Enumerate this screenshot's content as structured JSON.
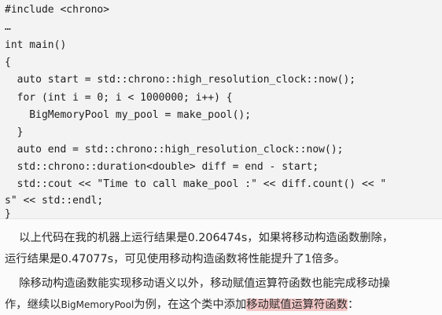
{
  "code": {
    "lines": [
      "#include <chrono>",
      "…",
      "int main()",
      "{",
      "  auto start = std::chrono::high_resolution_clock::now();",
      "  for (int i = 0; i < 1000000; i++) {",
      "    BigMemoryPool my_pool = make_pool();",
      "  }",
      "  auto end = std::chrono::high_resolution_clock::now();",
      "  std::chrono::duration<double> diff = end - start;",
      "  std::cout << \"Time to call make_pool :\" << diff.count() << \"",
      "s\" << std::endl;",
      "}"
    ]
  },
  "text": {
    "p1_line1": "    以上代码在我的机器上运行结果是0.206474s，如果将移动构造函数删除，",
    "p1_line2": "运行结果是0.47077s，可见使用移动构造函数将性能提升了1倍多。",
    "p2_line1": "    除移动构造函数能实现移动语义以外，移动赋值运算符函数也能完成移动操",
    "p2_line2_prefix": "作，继续以",
    "p2_line2_code": "BigMemoryPool",
    "p2_line2_mid": "为例，在这个类中添加",
    "p2_line2_highlight": "移动赋值运算符函数",
    "p2_line2_suffix": "："
  },
  "colors": {
    "code_bg": "#f3f3f3",
    "highlight": "#f4c8c8"
  }
}
